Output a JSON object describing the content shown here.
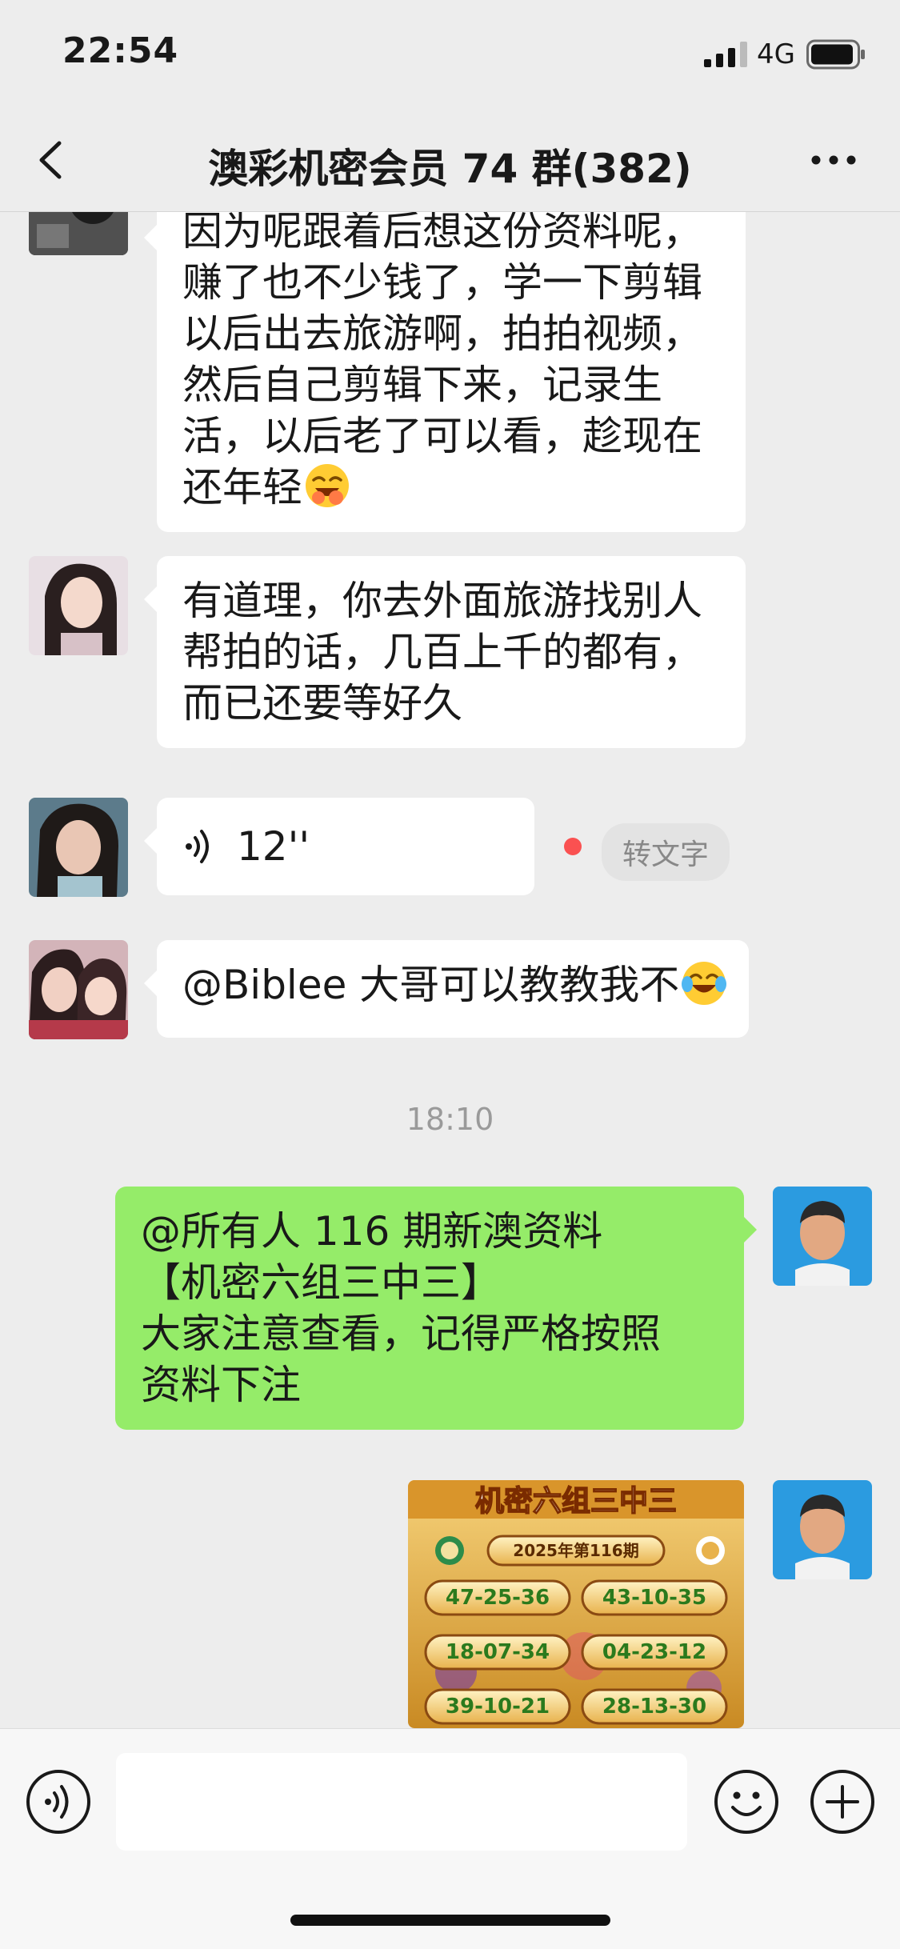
{
  "status_bar": {
    "time": "22:54",
    "network": "4G"
  },
  "nav": {
    "title": "澳彩机密会员 74 群(382)"
  },
  "messages": {
    "m1": {
      "lines": [
        "因为呢跟着后想这份资料呢，",
        "赚了也不少钱了，学一下剪辑",
        "以后出去旅游啊，拍拍视频，",
        "然后自己剪辑下来，记录生",
        "活，以后老了可以看，趁现在",
        "还年轻"
      ]
    },
    "m2": {
      "lines": [
        "有道理，你去外面旅游找别人",
        "帮拍的话，几百上千的都有，",
        "而已还要等好久"
      ]
    },
    "m3": {
      "duration": "12''",
      "convert_label": "转文字"
    },
    "m4": {
      "text": "@Biblee 大哥可以教教我不"
    },
    "time_divider": "18:10",
    "m5": {
      "lines": [
        "@所有人   116 期新澳资料",
        "【机密六组三中三】",
        "大家注意查看，记得严格按照",
        "资料下注"
      ]
    },
    "m6": {
      "title": "机密六组三中三",
      "period": "2025年第116期",
      "groups": [
        "47-25-36",
        "43-10-35",
        "18-07-34",
        "04-23-12",
        "39-10-21",
        "28-13-30"
      ]
    }
  },
  "colors": {
    "background": "#ededed",
    "sent_bubble": "#95ec69",
    "unread_dot": "#fa5151",
    "image_gold": "#e2a93a"
  },
  "icons": [
    "signal-icon",
    "battery-icon",
    "back-icon",
    "more-icon",
    "voice-icon",
    "laughing-emoji-icon",
    "tears-of-joy-emoji-icon",
    "voice-toggle-icon",
    "emoji-icon",
    "plus-icon"
  ]
}
